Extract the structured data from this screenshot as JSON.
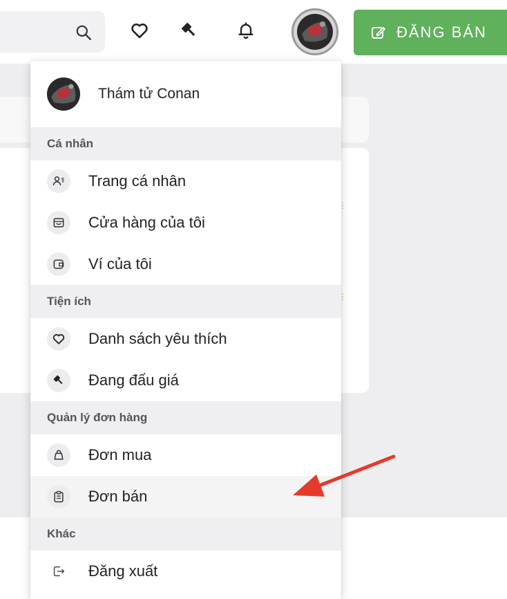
{
  "header": {
    "post_button_label": "ĐĂNG BÁN",
    "accent_color": "#5fb15c"
  },
  "icons": {
    "search": "search-icon",
    "favorites": "heart-icon",
    "auction": "gavel-icon",
    "notifications": "bell-icon",
    "post": "edit-icon"
  },
  "menu": {
    "user_name": "Thám tử Conan",
    "sections": [
      {
        "title": "Cá nhân",
        "items": [
          {
            "label": "Trang cá nhân",
            "icon": "user-profile-icon"
          },
          {
            "label": "Cửa hàng của tôi",
            "icon": "store-icon"
          },
          {
            "label": "Ví của tôi",
            "icon": "wallet-icon"
          }
        ]
      },
      {
        "title": "Tiện ích",
        "items": [
          {
            "label": "Danh sách yêu thích",
            "icon": "heart-icon"
          },
          {
            "label": "Đang đấu giá",
            "icon": "gavel-icon"
          }
        ]
      },
      {
        "title": "Quản lý đơn hàng",
        "items": [
          {
            "label": "Đơn mua",
            "icon": "shopping-bag-icon"
          },
          {
            "label": "Đơn bán",
            "icon": "clipboard-icon",
            "highlighted": true
          }
        ]
      },
      {
        "title": "Khác",
        "items": [
          {
            "label": "Đăng xuất",
            "icon": "logout-icon"
          }
        ]
      }
    ]
  },
  "annotation": {
    "arrow_color": "#e53a2b",
    "points_to": "Đơn bán"
  }
}
